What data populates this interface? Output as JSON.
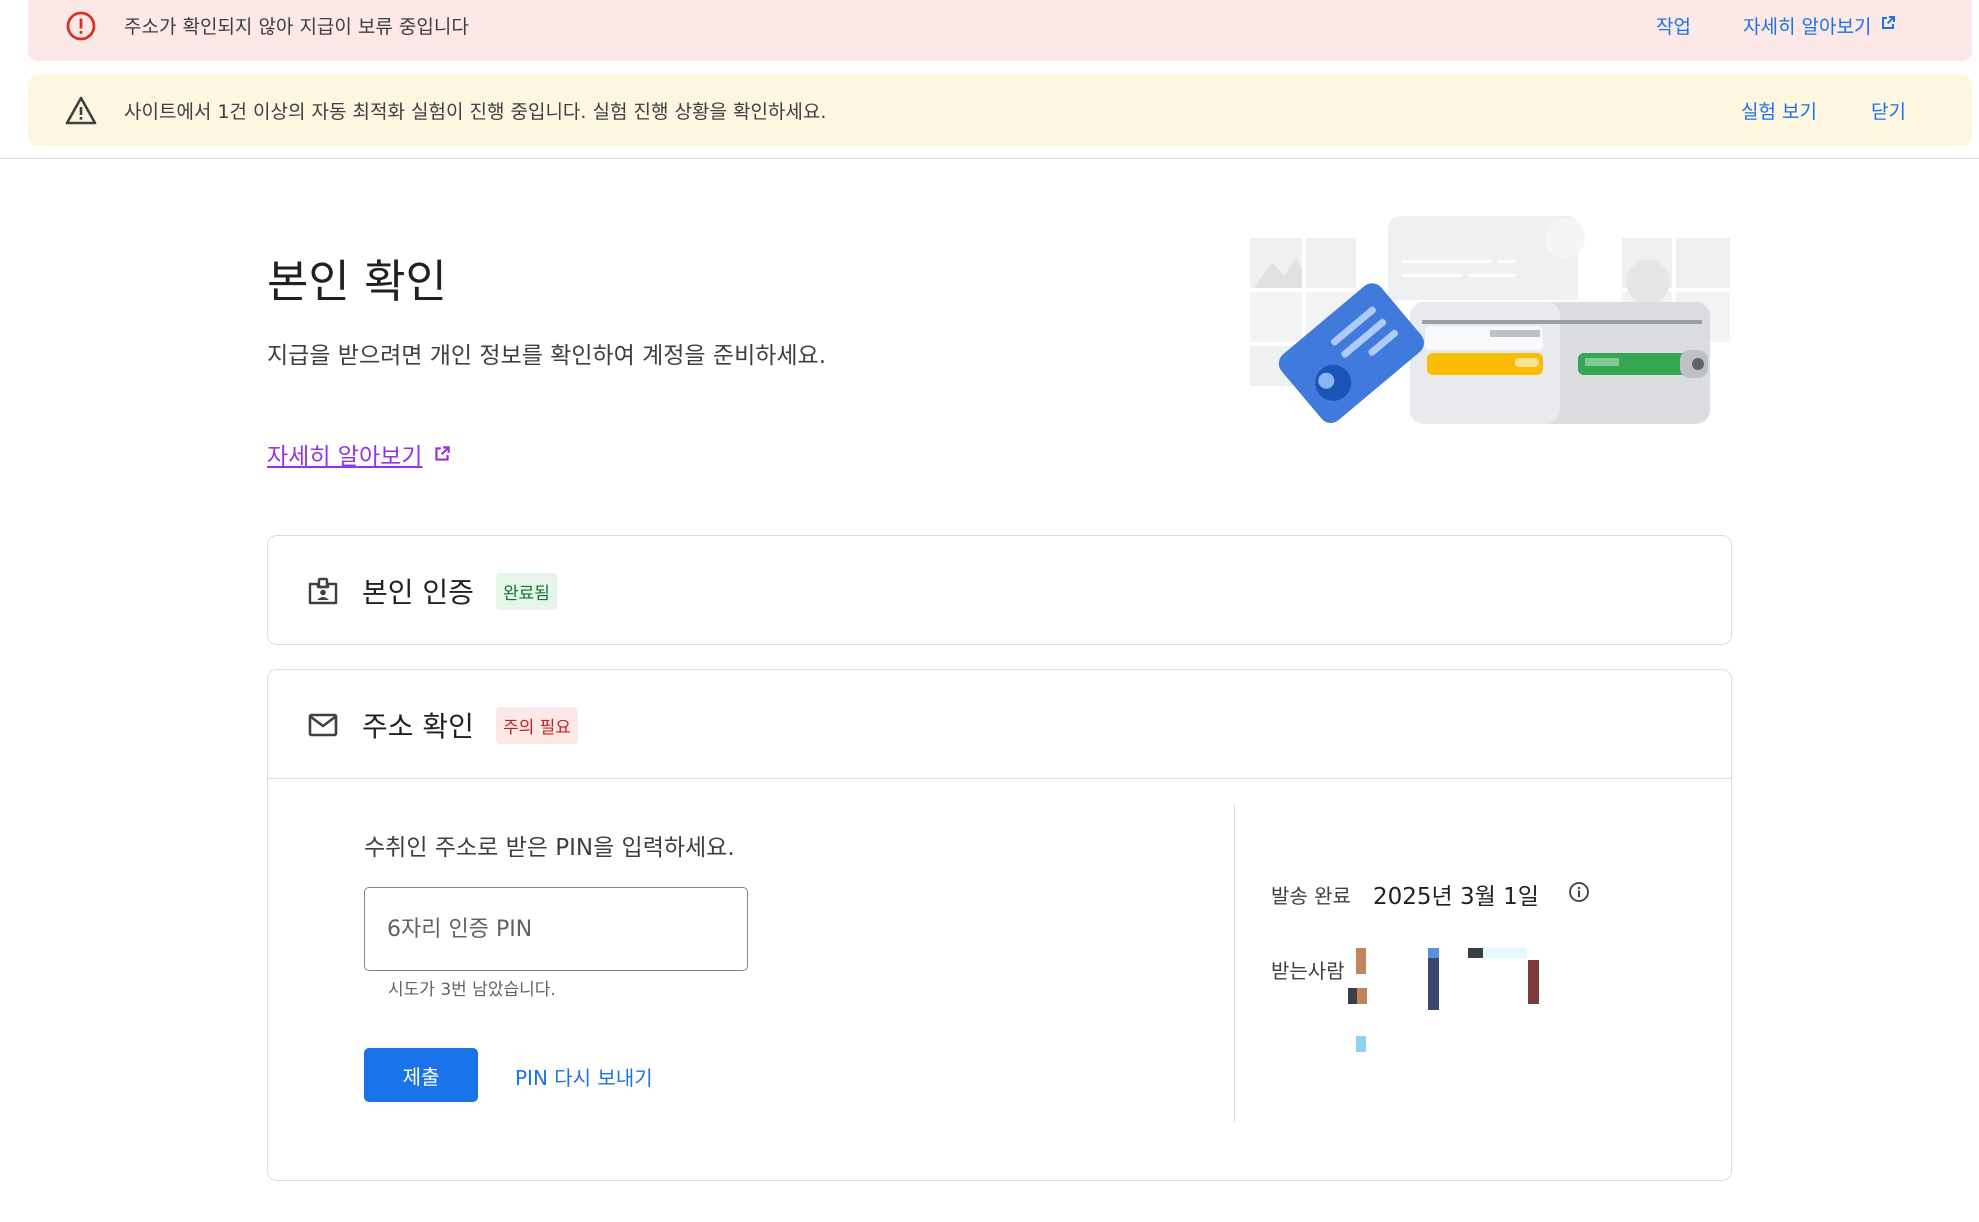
{
  "banners": {
    "error": {
      "icon": "error-circle-icon",
      "text": "주소가 확인되지 않아 지급이 보류 중입니다",
      "action_label": "작업",
      "learn_more_label": "자세히 알아보기",
      "color": "#fce8e6"
    },
    "warning": {
      "icon": "warning-triangle-icon",
      "text": "사이트에서 1건 이상의 자동 최적화 실험이 진행 중입니다. 실험 진행 상황을 확인하세요.",
      "view_label": "실험 보기",
      "close_label": "닫기",
      "color": "#fef7e0"
    }
  },
  "page": {
    "title": "본인 확인",
    "description": "지급을 받으려면 개인 정보를 확인하여 계정을 준비하세요.",
    "learn_more_label": "자세히 알아보기"
  },
  "identity_card": {
    "icon": "id-badge-icon",
    "title": "본인 인증",
    "status": "완료됨"
  },
  "address_card": {
    "icon": "mail-icon",
    "title": "주소 확인",
    "status": "주의 필요",
    "prompt": "수취인 주소로 받은 PIN을 입력하세요.",
    "pin_placeholder": "6자리 인증 PIN",
    "pin_value": "",
    "attempts_hint": "시도가 3번 남았습니다.",
    "submit_label": "제출",
    "resend_label": "PIN 다시 보내기",
    "sent_label": "발송 완료",
    "sent_date": "2025년 3월 1일",
    "recipient_label": "받는사람"
  },
  "colors": {
    "accent": "#1a73e8",
    "error": "#d93025",
    "success": "#137333",
    "link_visited": "#9334e6"
  }
}
